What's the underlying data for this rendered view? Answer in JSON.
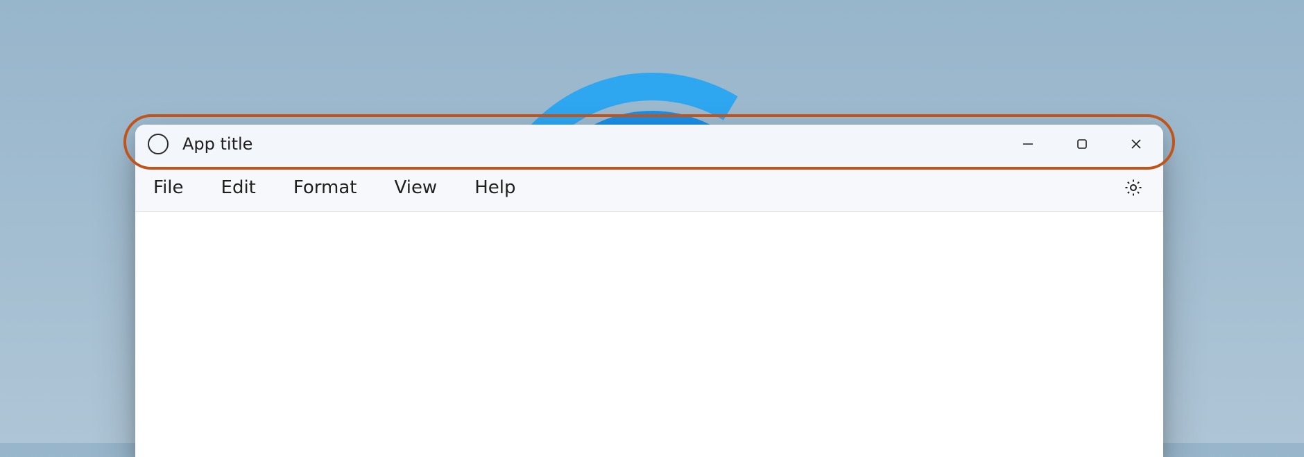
{
  "titlebar": {
    "app_title": "App title",
    "icons": {
      "app": "circle-icon",
      "minimize": "minimize-icon",
      "maximize": "maximize-icon",
      "close": "close-icon"
    }
  },
  "menubar": {
    "items": [
      {
        "label": "File"
      },
      {
        "label": "Edit"
      },
      {
        "label": "Format"
      },
      {
        "label": "View"
      },
      {
        "label": "Help"
      }
    ],
    "settings_icon": "gear-icon"
  },
  "annotation": {
    "highlighted_region": "titlebar",
    "highlight_color": "#c0541a"
  }
}
